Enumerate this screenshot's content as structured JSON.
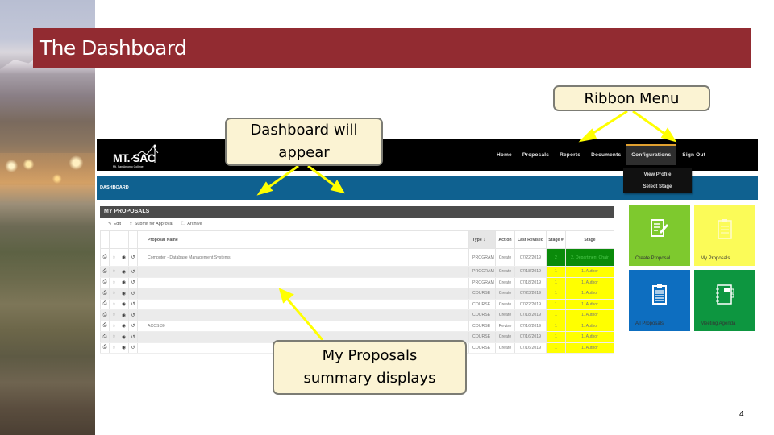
{
  "slide": {
    "title": "The Dashboard",
    "page_number": "4",
    "colors": {
      "title_bar": "#922b31",
      "callout_bg": "#fbf3d3",
      "arrow": "#ffff00"
    }
  },
  "callouts": {
    "ribbon": "Ribbon Menu",
    "dashboard": "Dashboard will appear",
    "proposals": "My Proposals summary displays"
  },
  "app": {
    "logo": {
      "name": "MT. SAC",
      "subtitle": "Mt. San Antonio College"
    },
    "nav": [
      {
        "label": "Home"
      },
      {
        "label": "Proposals"
      },
      {
        "label": "Reports"
      },
      {
        "label": "Documents"
      },
      {
        "label": "Configurations",
        "active": true
      },
      {
        "label": "Sign Out"
      }
    ],
    "dropdown": [
      {
        "label": "View Profile"
      },
      {
        "label": "Select Stage"
      }
    ],
    "subbar_label": "DASHBOARD",
    "panel": {
      "title": "MY PROPOSALS",
      "toolbar": [
        {
          "icon": "edit-icon",
          "glyph": "✎",
          "label": "Edit"
        },
        {
          "icon": "submit-icon",
          "glyph": "⇪",
          "label": "Submit for Approval"
        },
        {
          "icon": "archive-icon",
          "glyph": "🗀",
          "label": "Archive"
        }
      ],
      "columns": {
        "name": "Proposal Name",
        "type": "Type",
        "type_sort": "↓",
        "action": "Action",
        "last_revised": "Last Revised",
        "stage_num": "Stage #",
        "stage": "Stage"
      },
      "rows": [
        {
          "name": "Computer - Database Management Systems",
          "type": "PROGRAM",
          "action": "Create",
          "last_revised": "07/22/2019",
          "stage_num": "2",
          "stage": "2. Department Chair",
          "status": "green"
        },
        {
          "name": "",
          "type": "PROGRAM",
          "action": "Create",
          "last_revised": "07/18/2019",
          "stage_num": "1",
          "stage": "1. Author",
          "status": "yellow"
        },
        {
          "name": "",
          "type": "PROGRAM",
          "action": "Create",
          "last_revised": "07/18/2019",
          "stage_num": "1",
          "stage": "1. Author",
          "status": "yellow"
        },
        {
          "name": "",
          "type": "COURSE",
          "action": "Create",
          "last_revised": "07/23/2019",
          "stage_num": "1",
          "stage": "1. Author",
          "status": "yellow"
        },
        {
          "name": "",
          "type": "COURSE",
          "action": "Create",
          "last_revised": "07/22/2019",
          "stage_num": "1",
          "stage": "1. Author",
          "status": "yellow"
        },
        {
          "name": "",
          "type": "COURSE",
          "action": "Create",
          "last_revised": "07/18/2019",
          "stage_num": "1",
          "stage": "1. Author",
          "status": "yellow"
        },
        {
          "name": "ACCS 30",
          "type": "COURSE",
          "action": "Revise",
          "last_revised": "07/16/2019",
          "stage_num": "1",
          "stage": "1. Author",
          "status": "yellow"
        },
        {
          "name": "",
          "type": "COURSE",
          "action": "Create",
          "last_revised": "07/16/2019",
          "stage_num": "1",
          "stage": "1. Author",
          "status": "yellow"
        },
        {
          "name": "",
          "type": "COURSE",
          "action": "Create",
          "last_revised": "07/16/2019",
          "stage_num": "1",
          "stage": "1. Author",
          "status": "yellow"
        }
      ]
    },
    "tiles": [
      {
        "label": "Create Proposal",
        "icon": "edit-document-icon",
        "color": "#7ec92e"
      },
      {
        "label": "My Proposals",
        "icon": "clipboard-icon",
        "color": "#fbfb58"
      },
      {
        "label": "All Proposals",
        "icon": "clipboard-list-icon",
        "color": "#0d6ec0"
      },
      {
        "label": "Meeting Agenda",
        "icon": "notebook-icon",
        "color": "#0d9640"
      }
    ]
  }
}
